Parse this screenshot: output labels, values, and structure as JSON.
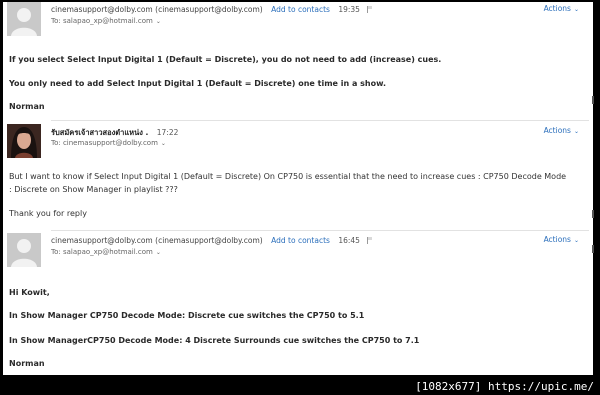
{
  "messages": [
    {
      "sender_address": "cinemasupport@dolby.com",
      "sender_paren": "(cinemasupport@dolby.com)",
      "add_contacts": "Add to contacts",
      "time": "19:35",
      "to": "To: salapao_xp@hotmail.com",
      "actions": "Actions",
      "body": [
        "If you select Select Input Digital 1 (Default = Discrete), you do not need to add (increase) cues.",
        "You only need to add Select Input Digital 1 (Default = Discrete) one time in a show.",
        "Norman"
      ]
    },
    {
      "sender_name": "รับสมัครเจ้าสาวสองตำแหน่ง .",
      "time": "17:22",
      "to": "To: cinemasupport@dolby.com",
      "actions": "Actions",
      "body": [
        "But I want to know if Select Input Digital 1 (Default = Discrete) On CP750 is essential that the need to increase cues : CP750 Decode Mode : Discrete on Show Manager in playlist ???",
        "Thank you for reply"
      ]
    },
    {
      "sender_address": "cinemasupport@dolby.com",
      "sender_paren": "(cinemasupport@dolby.com)",
      "add_contacts": "Add to contacts",
      "time": "16:45",
      "to": "To: salapao_xp@hotmail.com",
      "actions": "Actions",
      "body": [
        "Hi Kowit,",
        "In Show Manager CP750 Decode Mode: Discrete cue switches the CP750 to 5.1",
        "In Show ManagerCP750 Decode Mode: 4 Discrete Surrounds cue switches the CP750 to 7.1",
        "Norman"
      ]
    }
  ],
  "watermark": "[1082x677] https://upic.me/",
  "colors": {
    "link": "#2a6ebb",
    "background": "#ffffff",
    "frame": "#000000"
  },
  "icons": [
    "avatar-placeholder-icon",
    "avatar-photo",
    "flag-icon",
    "chevron-down-icon"
  ]
}
